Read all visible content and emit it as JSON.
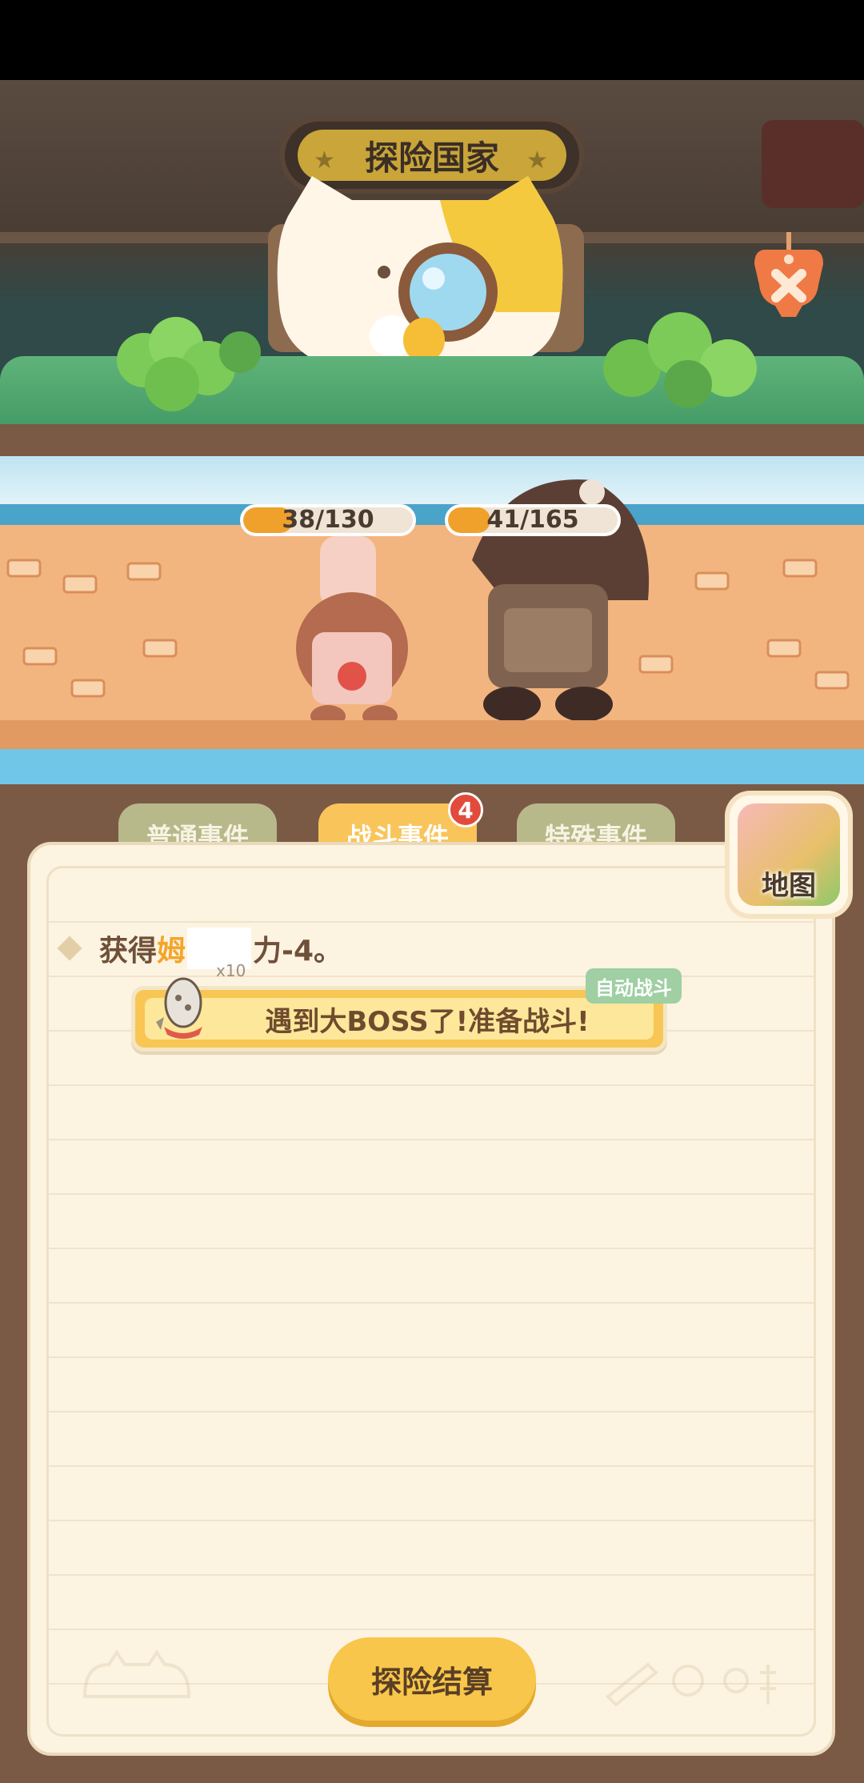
{
  "header": {
    "title": "探险国家",
    "close_icon": "close-x-icon"
  },
  "battle": {
    "player_hp": {
      "text": "38/130",
      "current": 38,
      "max": 130
    },
    "enemy_hp": {
      "text": "41/165",
      "current": 41,
      "max": 165
    }
  },
  "tabs": [
    {
      "label": "普通事件",
      "active": false
    },
    {
      "label": "战斗事件",
      "active": true,
      "badge": "4"
    },
    {
      "label": "特殊事件",
      "active": false
    }
  ],
  "map_button": {
    "label": "地图"
  },
  "log": {
    "line1_prefix": "获得",
    "line1_name": "姆",
    "line1_suffix": "力-4。",
    "line1_count": "x10",
    "boss_message": "遇到大BOSS了!准备战斗!",
    "auto_battle": "自动战斗"
  },
  "footer": {
    "settle_button": "探险结算"
  },
  "colors": {
    "accent_yellow": "#f8c654",
    "tab_inactive": "#b7b98a",
    "panel_brown": "#7b5a45",
    "badge_red": "#e24b3c"
  }
}
